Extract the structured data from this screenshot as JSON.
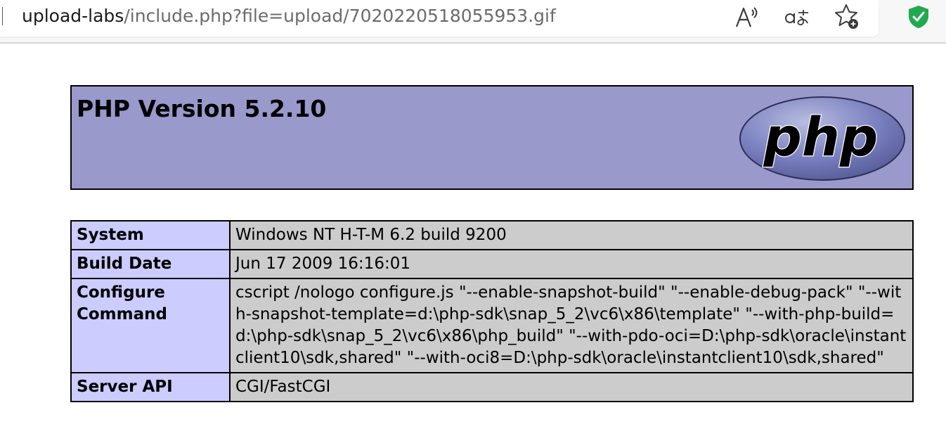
{
  "browser": {
    "url_host": "upload-labs",
    "url_path": "/include.php?file=upload/7020220518055953.gif",
    "icons": {
      "read_aloud": "read-aloud-icon",
      "translate": "translate-icon",
      "favorite": "add-favorite-icon",
      "shield": "shield-check-icon"
    },
    "colors": {
      "shield": "#22a94f"
    }
  },
  "phpinfo": {
    "title": "PHP Version 5.2.10",
    "logo_text": "php",
    "colors": {
      "header_bg": "#9999cc",
      "label_bg": "#ccccff",
      "value_bg": "#cccccc"
    },
    "rows": [
      {
        "label": "System",
        "value": "Windows NT H-T-M 6.2 build 9200"
      },
      {
        "label": "Build Date",
        "value": "Jun 17 2009 16:16:01"
      },
      {
        "label": "Configure Command",
        "value": "cscript /nologo configure.js \"--enable-snapshot-build\" \"--enable-debug-pack\" \"--with-snapshot-template=d:\\php-sdk\\snap_5_2\\vc6\\x86\\template\" \"--with-php-build=d:\\php-sdk\\snap_5_2\\vc6\\x86\\php_build\" \"--with-pdo-oci=D:\\php-sdk\\oracle\\instantclient10\\sdk,shared\" \"--with-oci8=D:\\php-sdk\\oracle\\instantclient10\\sdk,shared\""
      },
      {
        "label": "Server API",
        "value": "CGI/FastCGI"
      }
    ]
  }
}
